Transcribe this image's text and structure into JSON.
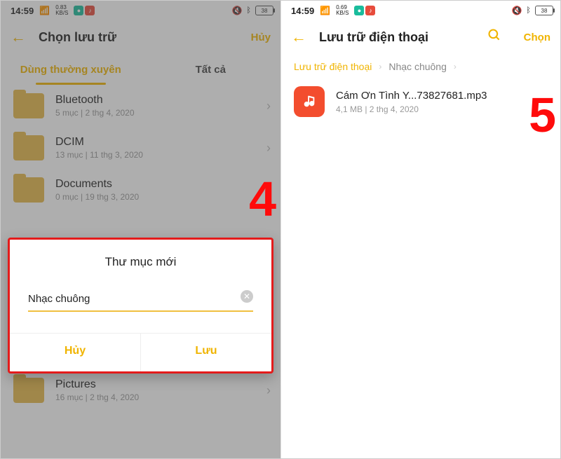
{
  "left": {
    "status": {
      "time": "14:59",
      "net": "0.83\nKB/S",
      "battery": "38"
    },
    "header": {
      "title": "Chọn lưu trữ",
      "cancel": "Hủy"
    },
    "tabs": {
      "frequent": "Dùng thường xuyên",
      "all": "Tất cả"
    },
    "folders": [
      {
        "name": "Bluetooth",
        "meta": "5 mục | 2 thg 4, 2020"
      },
      {
        "name": "DCIM",
        "meta": "13 mục | 11 thg 3, 2020"
      },
      {
        "name": "Documents",
        "meta": "0 mục | 19 thg 3, 2020"
      },
      {
        "name": "Pictures",
        "meta": "16 mục | 2 thg 4, 2020"
      }
    ],
    "dialog": {
      "title": "Thư mục mới",
      "value": "Nhạc chuông",
      "cancel": "Hủy",
      "save": "Lưu"
    },
    "step": "4"
  },
  "right": {
    "status": {
      "time": "14:59",
      "net": "0.69\nKB/S",
      "battery": "38"
    },
    "header": {
      "title": "Lưu trữ điện thoại",
      "select": "Chọn"
    },
    "breadcrumb": {
      "root": "Lưu trữ điện thoại",
      "current": "Nhạc chuông"
    },
    "file": {
      "name": "Cám Ơn Tình Y...73827681.mp3",
      "meta": "4,1 MB | 2 thg 4, 2020"
    },
    "step": "5"
  }
}
